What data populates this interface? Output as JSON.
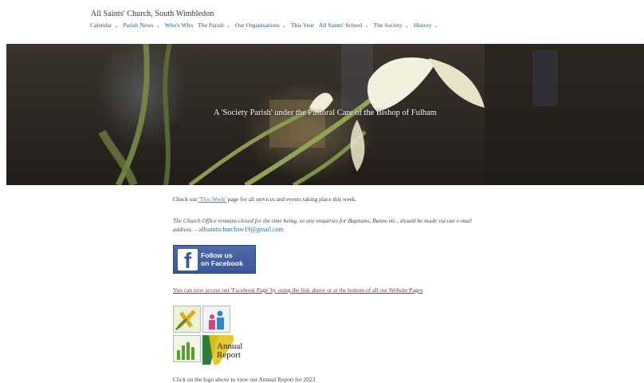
{
  "site": {
    "title": "All Saints' Church, South Wimbledon"
  },
  "nav": [
    {
      "label": "Calendar",
      "dropdown": true
    },
    {
      "label": "Parish News",
      "dropdown": true
    },
    {
      "label": "Who's Who",
      "dropdown": false
    },
    {
      "label": "The Parish",
      "dropdown": true
    },
    {
      "label": "Our Organisations",
      "dropdown": true
    },
    {
      "label": "This Year",
      "dropdown": false
    },
    {
      "label": "All Saints' School",
      "dropdown": true
    },
    {
      "label": "The Society",
      "dropdown": true
    },
    {
      "label": "History",
      "dropdown": true
    }
  ],
  "hero": {
    "caption": "A 'Society Parish' under the Pastoral Care of the Bishop of Fulham"
  },
  "content": {
    "p1_before": "Check our ",
    "p1_link": "'This Week'",
    "p1_after": " page for all services and events taking place this week.",
    "p2_text": "The Church Office remains closed for the time being, so any enquiries for Baptisms, Banns etc., should be made via our e-mail address: – ",
    "p2_email": "allsaintschurchsw19@gmail.com",
    "facebook": {
      "line1": "Follow us",
      "line2": "on Facebook",
      "glyph": "f"
    },
    "p3_link": "You can now access our 'Facebook Page' by using the link above or at the bottom of all our Website Pages",
    "annual_report": {
      "line1": "Annual",
      "line2": "Report"
    },
    "p4": "Click on the logo above to view our Annual Report for 2023"
  },
  "colors": {
    "nav_link": "#1e5a8a",
    "link": "#4a7fa8",
    "accent_link": "#8a3040",
    "facebook": "#3b5998"
  }
}
